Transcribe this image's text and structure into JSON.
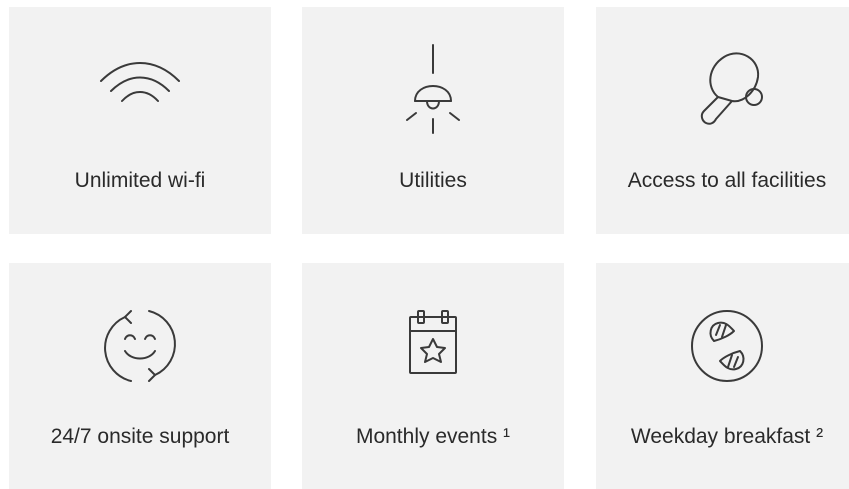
{
  "amenities": [
    {
      "label": "Unlimited wi-fi",
      "icon": "wifi-icon"
    },
    {
      "label": "Utilities",
      "icon": "lamp-icon"
    },
    {
      "label": "Access to all facilities",
      "icon": "ping-pong-icon"
    },
    {
      "label": "24/7 onsite support",
      "icon": "smiley-refresh-icon"
    },
    {
      "label": "Monthly events ¹",
      "icon": "calendar-star-icon"
    },
    {
      "label": "Weekday breakfast ²",
      "icon": "croissant-icon"
    }
  ],
  "colors": {
    "card_background": "#f2f2f2",
    "icon_stroke": "#3a3a3a",
    "text": "#2a2a2a"
  }
}
